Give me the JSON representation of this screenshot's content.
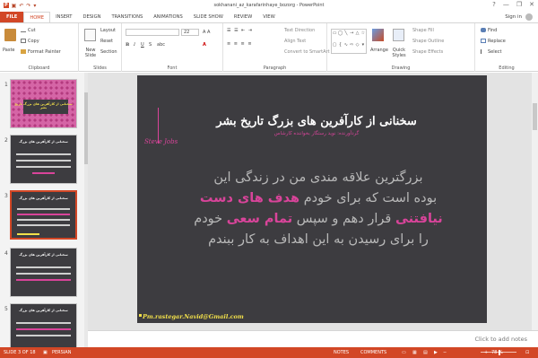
{
  "app": {
    "title": "sokhanani_az_karafarinhaye_bozorg - PowerPoint"
  },
  "titlebar": {
    "window_buttons": [
      "?",
      "—",
      "❐",
      "✕"
    ]
  },
  "ribbon_tabs": [
    {
      "label": "FILE"
    },
    {
      "label": "HOME"
    },
    {
      "label": "INSERT"
    },
    {
      "label": "DESIGN"
    },
    {
      "label": "TRANSITIONS"
    },
    {
      "label": "ANIMATIONS"
    },
    {
      "label": "SLIDE SHOW"
    },
    {
      "label": "REVIEW"
    },
    {
      "label": "VIEW"
    }
  ],
  "account": {
    "sign_in": "Sign in"
  },
  "ribbon": {
    "clipboard": {
      "label": "Clipboard",
      "paste": "Paste",
      "cut": "Cut",
      "copy": "Copy",
      "format_painter": "Format Painter"
    },
    "slides": {
      "label": "Slides",
      "new_slide": "New Slide",
      "layout": "Layout",
      "reset": "Reset",
      "section": "Section"
    },
    "font": {
      "label": "Font",
      "size": "22"
    },
    "paragraph": {
      "label": "Paragraph",
      "text_direction": "Text Direction",
      "align_text": "Align Text",
      "convert_smartart": "Convert to SmartArt"
    },
    "drawing": {
      "label": "Drawing",
      "arrange": "Arrange",
      "quick_styles": "Quick Styles",
      "shape_fill": "Shape Fill",
      "shape_outline": "Shape Outline",
      "shape_effects": "Shape Effects"
    },
    "editing": {
      "label": "Editing",
      "find": "Find",
      "replace": "Replace",
      "select": "Select"
    }
  },
  "thumbnails": [
    {
      "num": "1",
      "title": "سخنانی از کارآفرین های بزرگ تاریخ بشر"
    },
    {
      "num": "2",
      "title": "سخنانی از کارآفرین های بزرگ"
    },
    {
      "num": "3",
      "title": "سخنانی از کارآفرین های بزرگ"
    },
    {
      "num": "4",
      "title": "سخنانی از کارآفرین های بزرگ"
    },
    {
      "num": "5",
      "title": "سخنانی از کارآفرین های بزرگ"
    }
  ],
  "slide": {
    "title": "سخنانی از کارآفرین های بزرگ تاریخ بشر",
    "subtitle": "گردآورنده: نوید رستگار بخواننده کارشاس",
    "author": "Steve Jobs",
    "body_line1": "بزرگترین علاقه مندی من در زندگی این",
    "body_line2a": "بوده است که برای خودم",
    "body_line2_hl": "هدف های دست",
    "body_line3_hl1": "نیافتنی",
    "body_line3b": "قرار دهم و سپس",
    "body_line3_hl2": "تمام سعی",
    "body_line3c": "خودم",
    "body_line4": "را برای رسیدن به این اهداف به کار ببندم",
    "email": "Pm.rastegar.Navid@Gmail.com"
  },
  "notes": {
    "placeholder": "Click to add notes"
  },
  "status": {
    "slide_info": "SLIDE 3 OF 18",
    "language": "PERSIAN",
    "notes": "NOTES",
    "comments": "COMMENTS",
    "zoom": "78 %"
  },
  "colors": {
    "accent": "#d24726",
    "slide_bg": "#3d3c40",
    "highlight": "#d9449a",
    "email": "#f2e04a"
  }
}
